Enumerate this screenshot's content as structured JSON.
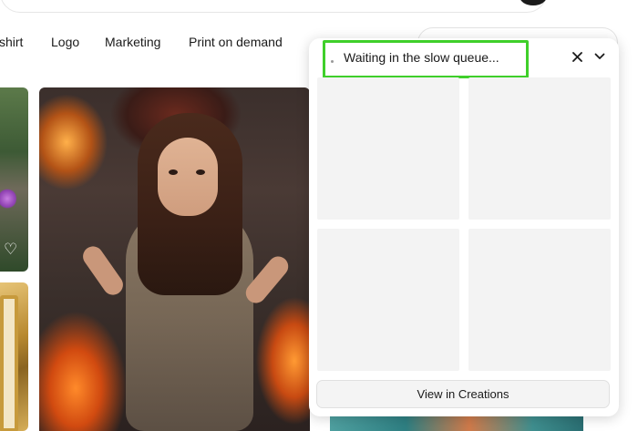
{
  "nav": {
    "items": [
      "shirt",
      "Logo",
      "Marketing",
      "Print on demand"
    ]
  },
  "panel": {
    "status": "Waiting in the slow queue...",
    "view_button": "View in Creations",
    "icons": [
      "close-icon",
      "chevron-down-icon"
    ]
  },
  "gallery": {
    "like_icon": "heart-icon"
  },
  "colors": {
    "highlight": "#3fcf2a",
    "placeholder": "#f3f3f3"
  }
}
